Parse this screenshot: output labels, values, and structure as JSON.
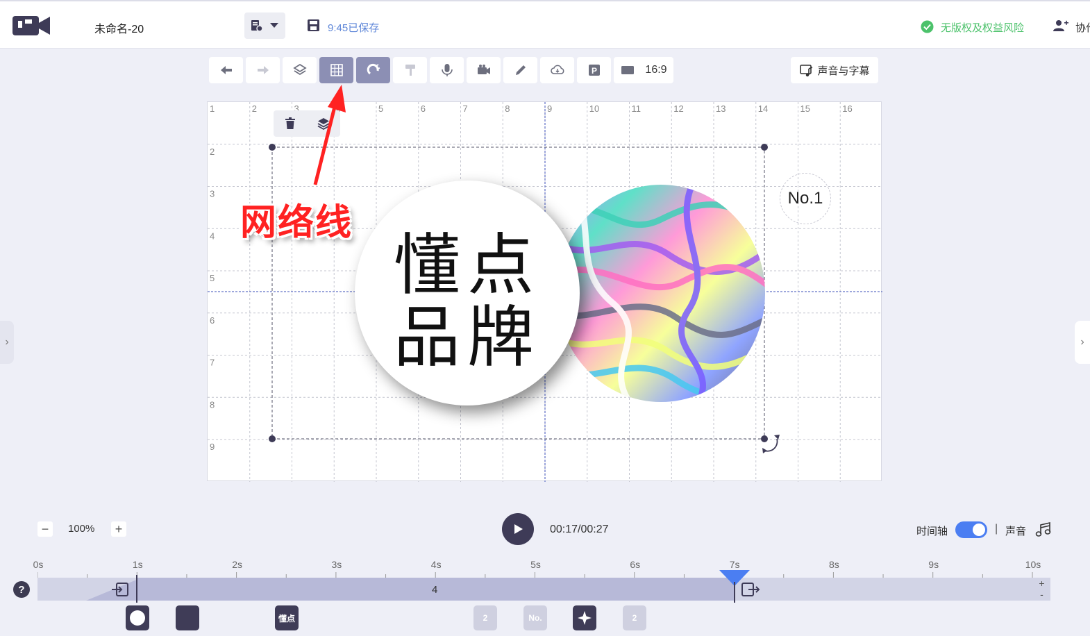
{
  "header": {
    "doc_title": "未命名-20",
    "save_status": "9:45已保存",
    "rights_text": "无版权及权益风险",
    "collab_text": "协作"
  },
  "toolbar": {
    "buttons": [
      "undo-icon",
      "redo-icon",
      "layers-icon",
      "grid-icon",
      "magnet-icon",
      "format-brush-icon",
      "microphone-icon",
      "camera-icon",
      "pen-icon",
      "cloud-icon",
      "p-icon",
      "aspect-icon"
    ],
    "active": [
      "grid",
      "magnet"
    ],
    "ratio_label": "16:9",
    "sound_subtitle_label": "声音与字幕"
  },
  "canvas": {
    "col_labels": [
      "1",
      "2",
      "3",
      "4",
      "5",
      "6",
      "7",
      "8",
      "9",
      "10",
      "11",
      "12",
      "13",
      "14",
      "15",
      "16"
    ],
    "row_labels": [
      "2",
      "3",
      "4",
      "5",
      "6",
      "7",
      "8",
      "9"
    ],
    "badge_text": "No.1",
    "brand_line1": "懂点",
    "brand_line2": "品牌",
    "annotation": "网络线"
  },
  "controls": {
    "zoom_minus": "−",
    "zoom_level": "100%",
    "zoom_plus": "+",
    "time": "00:17/00:27",
    "timeline_label": "时间轴",
    "timeline_toggle_on": true,
    "divider": "|",
    "sound_label": "声音"
  },
  "timeline": {
    "ticks": [
      "0s",
      "1s",
      "2s",
      "3s",
      "4s",
      "5s",
      "6s",
      "7s",
      "8s",
      "9s",
      "10s"
    ],
    "track_count": "4",
    "playhead_seconds": 7,
    "help": "?",
    "plus": "+",
    "minus": "-",
    "keyframes": [
      {
        "label": "",
        "style": "dark"
      },
      {
        "label": "",
        "style": "dark"
      },
      {
        "label": "懂点",
        "style": "dark"
      },
      {
        "label": "2",
        "style": "light"
      },
      {
        "label": "No.",
        "style": "light"
      },
      {
        "label": "",
        "style": "dark"
      },
      {
        "label": "2",
        "style": "light"
      }
    ]
  },
  "colors": {
    "accent": "#4b7ef2",
    "dark": "#3e3b57",
    "save": "#5e86d8",
    "ok": "#4cc26b",
    "annotation": "#ff2222"
  }
}
